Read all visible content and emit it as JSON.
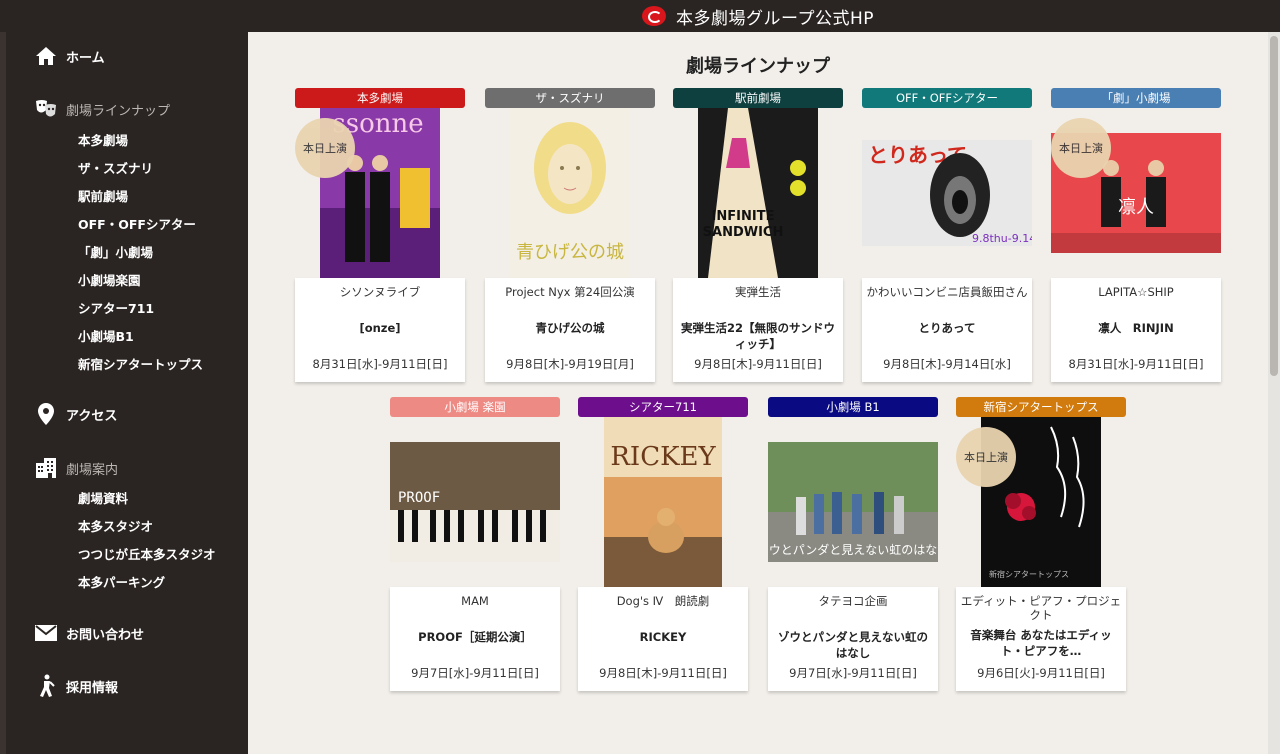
{
  "header": {
    "title": "本多劇場グループ公式HP",
    "logo_icon": "honda-theater-logo-icon"
  },
  "sidebar": {
    "home": "ホーム",
    "lineup": "劇場ラインナップ",
    "lineup_items": [
      "本多劇場",
      "ザ・スズナリ",
      "駅前劇場",
      "OFF・OFFシアター",
      "「劇」小劇場",
      "小劇場楽園",
      "シアター711",
      "小劇場B1",
      "新宿シアタートップス"
    ],
    "access": "アクセス",
    "guide": "劇場案内",
    "guide_items": [
      "劇場資料",
      "本多スタジオ",
      "つつじが丘本多スタジオ",
      "本多パーキング"
    ],
    "contact": "お問い合わせ",
    "recruit": "採用情報"
  },
  "main": {
    "title": "劇場ラインナップ",
    "badge_text": "本日上演",
    "cards": [
      {
        "theater": "本多劇場",
        "color": "#cc1a1a",
        "troupe": "シソンヌライブ",
        "title": "[onze]",
        "date": "8月31日[水]-9月11日[日]",
        "today": true
      },
      {
        "theater": "ザ・スズナリ",
        "color": "#6e6e6e",
        "troupe": "Project Nyx 第24回公演",
        "title": "青ひげ公の城",
        "date": "9月8日[木]-9月19日[月]",
        "today": false
      },
      {
        "theater": "駅前劇場",
        "color": "#0f4040",
        "troupe": "実弾生活",
        "title": "実弾生活22【無限のサンドウィッチ】",
        "date": "9月8日[木]-9月11日[日]",
        "today": false
      },
      {
        "theater": "OFF・OFFシアター",
        "color": "#11797a",
        "troupe": "かわいいコンビニ店員飯田さん",
        "title": "とりあって",
        "date": "9月8日[木]-9月14日[水]",
        "today": false
      },
      {
        "theater": "「劇」小劇場",
        "color": "#4a7fb4",
        "troupe": "LAPITA☆SHIP",
        "title": "凛人　RINJIN",
        "date": "8月31日[水]-9月11日[日]",
        "today": true
      },
      {
        "theater": "小劇場 楽園",
        "color": "#ee8a84",
        "troupe": "MAM",
        "title": "PROOF［延期公演］",
        "date": "9月7日[水]-9月11日[日]",
        "today": false
      },
      {
        "theater": "シアター711",
        "color": "#6d0f8c",
        "troupe": "Dog's Ⅳ　朗読劇",
        "title": "RICKEY",
        "date": "9月8日[木]-9月11日[日]",
        "today": false
      },
      {
        "theater": "小劇場 B1",
        "color": "#0a0a82",
        "troupe": "タテヨコ企画",
        "title": "ゾウとパンダと見えない虹のはなし",
        "date": "9月7日[水]-9月11日[日]",
        "today": false
      },
      {
        "theater": "新宿シアタートップス",
        "color": "#d17a0e",
        "troupe": "エディット・ピアフ・プロジェクト",
        "title": "音楽舞台 あなたはエディット・ピアフを…",
        "date": "9月6日[火]-9月11日[日]",
        "today": true
      }
    ]
  }
}
